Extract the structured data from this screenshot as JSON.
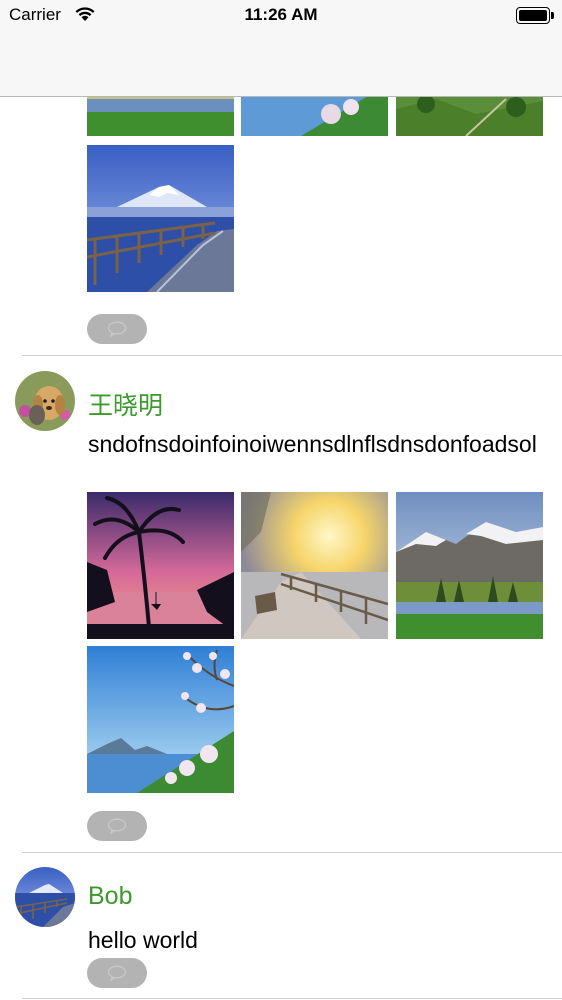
{
  "status_bar": {
    "carrier": "Carrier",
    "time": "11:26 AM"
  },
  "feed": [
    {
      "images": [
        "meadow-lake-photo",
        "blossom-lake-photo",
        "green-hills-photo",
        "snow-mountain-boardwalk-photo"
      ]
    },
    {
      "username": "王晓明",
      "content": "sndofnsdoinfoinoiwennsdlnflsdnsdonfoadsol",
      "images": [
        "palm-sunset-photo",
        "sunny-boardwalk-photo",
        "snowy-mountain-valley-photo",
        "blossom-lake-photo"
      ]
    },
    {
      "username": "Bob",
      "content": "hello world",
      "images": []
    }
  ],
  "colors": {
    "username": "#3c9a2c",
    "comment_button": "#b3b3b3",
    "nav_background": "#f7f7f8"
  },
  "icons": [
    "wifi-icon",
    "battery-icon",
    "comment-bubble-icon"
  ]
}
